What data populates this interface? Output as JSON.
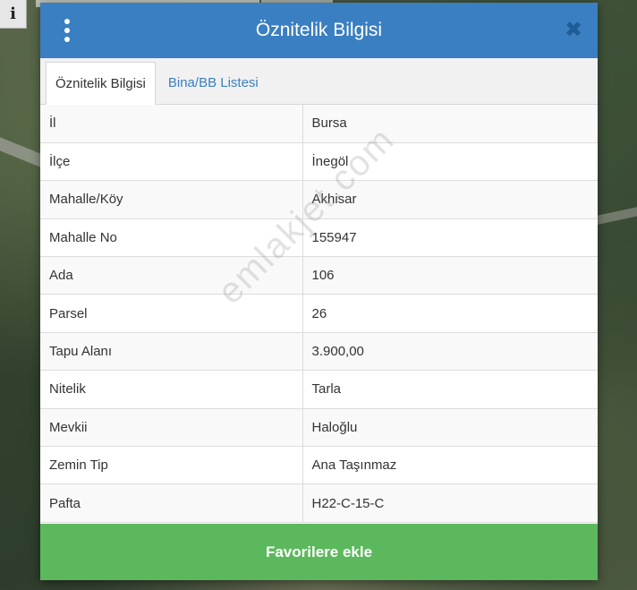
{
  "map": {
    "info_icon": "i"
  },
  "modal": {
    "title": "Öznitelik Bilgisi",
    "close_icon": "✖"
  },
  "tabs": [
    {
      "label": "Öznitelik Bilgisi",
      "active": true
    },
    {
      "label": "Bina/BB Listesi",
      "active": false
    }
  ],
  "attributes": [
    {
      "key": "İl",
      "value": "Bursa"
    },
    {
      "key": "İlçe",
      "value": "İnegöl"
    },
    {
      "key": "Mahalle/Köy",
      "value": "Akhisar"
    },
    {
      "key": "Mahalle No",
      "value": "155947"
    },
    {
      "key": "Ada",
      "value": "106"
    },
    {
      "key": "Parsel",
      "value": "26"
    },
    {
      "key": "Tapu Alanı",
      "value": "3.900,00"
    },
    {
      "key": "Nitelik",
      "value": "Tarla"
    },
    {
      "key": "Mevkii",
      "value": "Haloğlu"
    },
    {
      "key": "Zemin Tip",
      "value": "Ana Taşınmaz"
    },
    {
      "key": "Pafta",
      "value": "H22-C-15-C"
    }
  ],
  "watermark": "emlakjet.com",
  "footer": {
    "favorite_label": "Favorilere ekle"
  },
  "colors": {
    "header": "#3a7fc1",
    "favorite_button": "#5cb85c",
    "close_icon": "#1f5c96"
  }
}
